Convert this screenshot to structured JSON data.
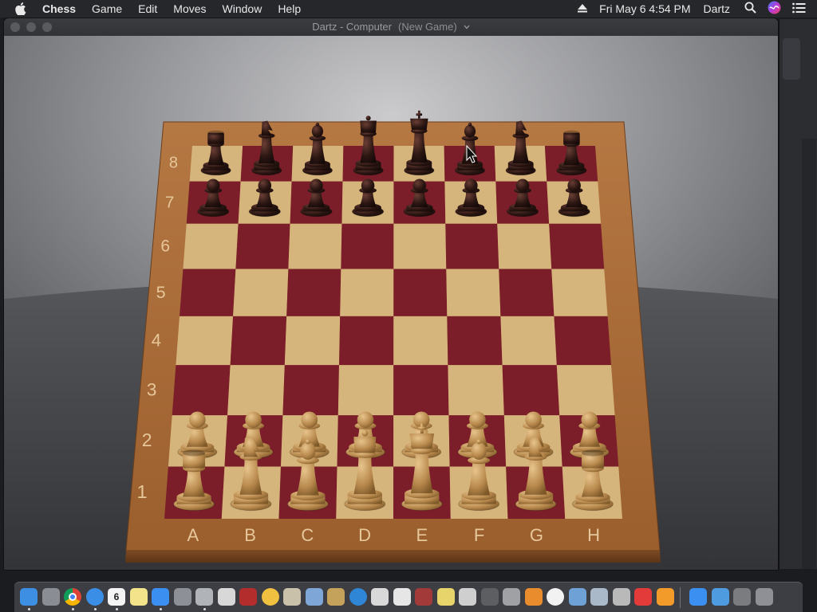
{
  "menubar": {
    "app_name": "Chess",
    "items": [
      "Game",
      "Edit",
      "Moves",
      "Window",
      "Help"
    ],
    "datetime": "Fri May 6  4:54 PM",
    "user": "Dartz"
  },
  "window": {
    "title": "Dartz - Computer",
    "subtitle": "(New Game)"
  },
  "board": {
    "files": [
      "A",
      "B",
      "C",
      "D",
      "E",
      "F",
      "G",
      "H"
    ],
    "ranks": [
      "8",
      "7",
      "6",
      "5",
      "4",
      "3",
      "2",
      "1"
    ],
    "light_square_color": "#d6b57c",
    "dark_square_color": "#7b1e2a",
    "frame_color": "#a6693a",
    "black_piece_color": "#2b1612",
    "white_piece_color": "#b98a4e",
    "position": {
      "8": [
        "rook",
        "knight",
        "bishop",
        "queen",
        "king",
        "bishop",
        "knight",
        "rook"
      ],
      "7": [
        "pawn",
        "pawn",
        "pawn",
        "pawn",
        "pawn",
        "pawn",
        "pawn",
        "pawn"
      ],
      "2": [
        "pawn",
        "pawn",
        "pawn",
        "pawn",
        "pawn",
        "pawn",
        "pawn",
        "pawn"
      ],
      "1": [
        "rook",
        "knight",
        "bishop",
        "queen",
        "king",
        "bishop",
        "knight",
        "rook"
      ]
    },
    "black_ranks": [
      "8",
      "7"
    ],
    "white_ranks": [
      "2",
      "1"
    ]
  },
  "dock": {
    "calendar_day": "6",
    "apps": [
      {
        "name": "finder",
        "color": "#3d8fe3"
      },
      {
        "name": "launchpad",
        "color": "#8a8d94"
      },
      {
        "name": "chrome",
        "color": "#e8e8e8"
      },
      {
        "name": "safari",
        "color": "#3a8ee6"
      },
      {
        "name": "calendar",
        "color": "#f4f4f4"
      },
      {
        "name": "notes",
        "color": "#f3e38a"
      },
      {
        "name": "app-store",
        "color": "#3b8ff0"
      },
      {
        "name": "system-preferences",
        "color": "#8d9096"
      },
      {
        "name": "chess",
        "color": "#b0b3b8"
      },
      {
        "name": "text-file",
        "color": "#d8d8d8"
      },
      {
        "name": "photo-booth",
        "color": "#b32d2d"
      },
      {
        "name": "photos",
        "color": "#f0c040"
      },
      {
        "name": "chess-knight",
        "color": "#c9c1aa"
      },
      {
        "name": "preview",
        "color": "#7ea6d6"
      },
      {
        "name": "grapher",
        "color": "#c5a25c"
      },
      {
        "name": "edge",
        "color": "#2f86d6"
      },
      {
        "name": "notepad",
        "color": "#d9d9d9"
      },
      {
        "name": "textedit",
        "color": "#e6e6e6"
      },
      {
        "name": "dictionary",
        "color": "#a33a3a"
      },
      {
        "name": "stickies",
        "color": "#e7d46a"
      },
      {
        "name": "font-book",
        "color": "#cfcfcf"
      },
      {
        "name": "activity-monitor",
        "color": "#5c5e62"
      },
      {
        "name": "disk-utility",
        "color": "#9fa1a5"
      },
      {
        "name": "home",
        "color": "#e98c2e"
      },
      {
        "name": "itunes",
        "color": "#f2f2f2"
      },
      {
        "name": "image-viewer",
        "color": "#6ea1d6"
      },
      {
        "name": "photo-editor",
        "color": "#a9b9c9"
      },
      {
        "name": "automator",
        "color": "#b9b9b9"
      },
      {
        "name": "blocked",
        "color": "#e33a3a"
      },
      {
        "name": "books",
        "color": "#f29a2a"
      },
      {
        "name": "app-store-2",
        "color": "#3b8ff0"
      },
      {
        "name": "folder",
        "color": "#4f9be0"
      },
      {
        "name": "minimized-window",
        "color": "#7b7c80"
      },
      {
        "name": "trash",
        "color": "#8e9095"
      }
    ]
  }
}
